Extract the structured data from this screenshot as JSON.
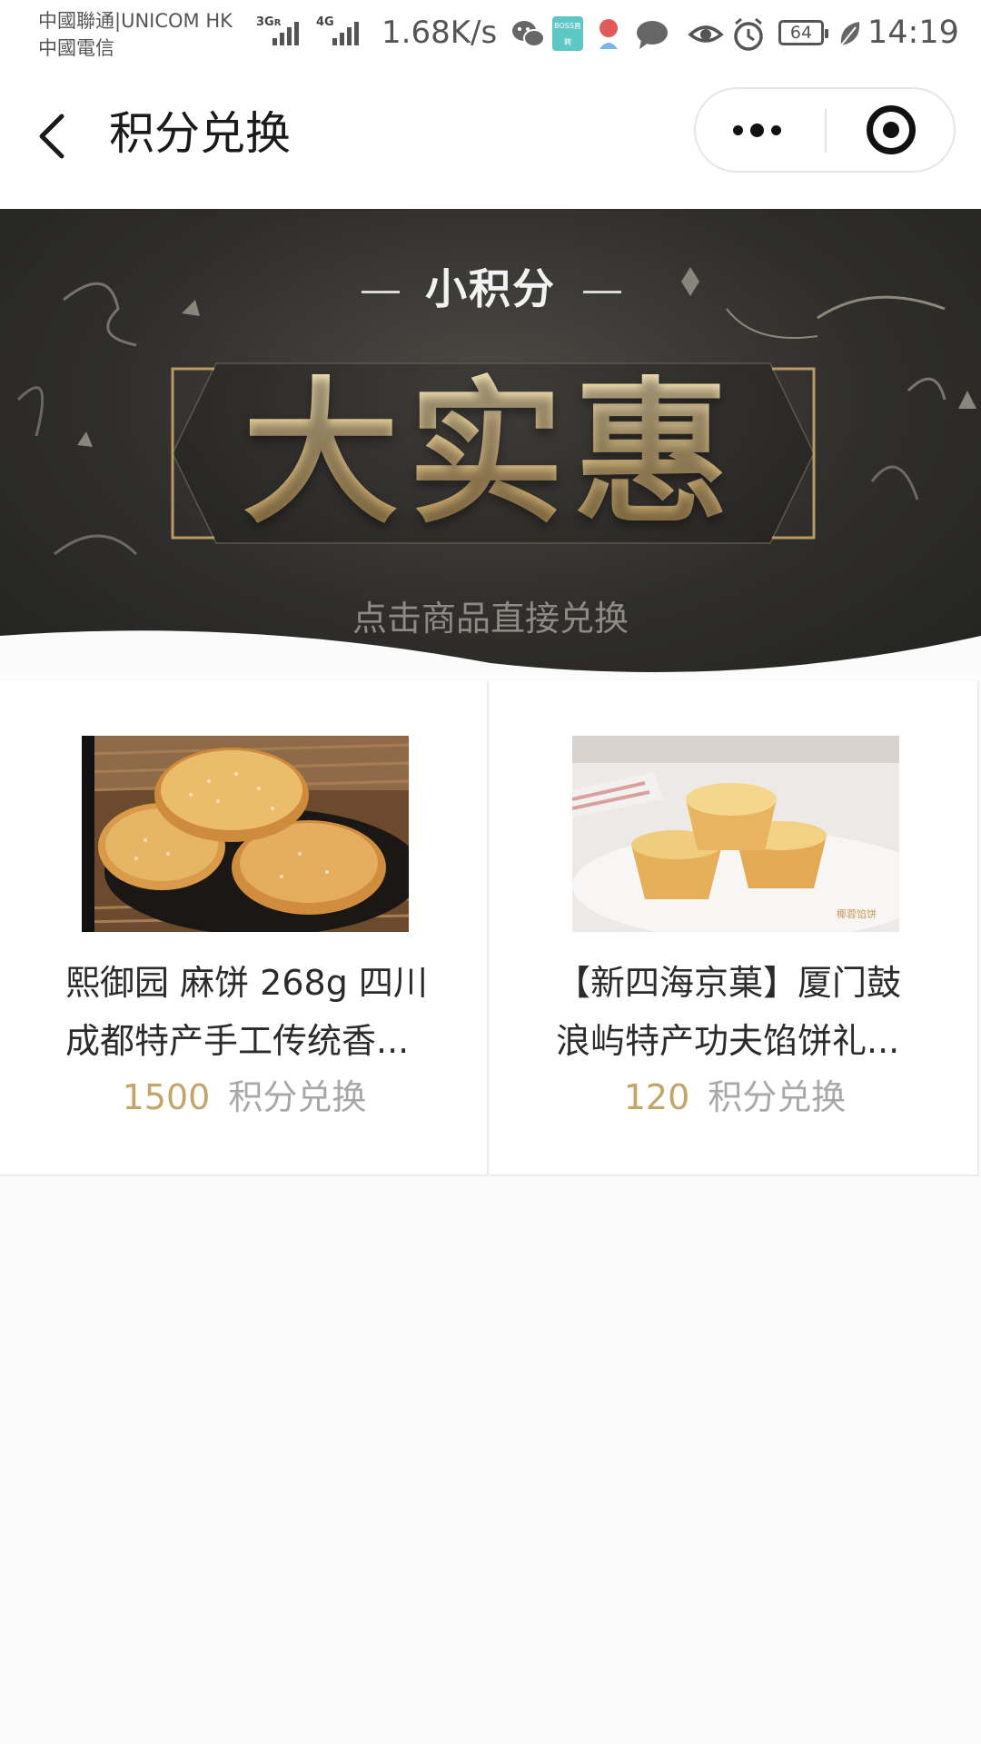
{
  "status_bar": {
    "carrier_line1": "中國聯通|UNICOM HK",
    "carrier_line2": "中國電信",
    "network_1": "3G",
    "network_1_suffix": "R",
    "network_2": "4G",
    "network_speed": "1.68K/s",
    "app_badge_label": "BOSS直聘",
    "battery_level": "64",
    "time": "14:19"
  },
  "nav": {
    "title": "积分兑换",
    "icons": [
      "back-arrow-icon",
      "more-dots-icon",
      "close-target-icon"
    ]
  },
  "banner": {
    "subtitle": "小积分",
    "headline": "大实惠",
    "hint": "点击商品直接兑换"
  },
  "products": [
    {
      "name_line1": "熙御园 麻饼 268g 四川",
      "name_line2": "成都特产手工传统香...",
      "price": "1500",
      "price_unit": "积分兑换",
      "image": "sesame-cakes-image"
    },
    {
      "name_line1": "【新四海京菓】厦门鼓",
      "name_line2": "浪屿特产功夫馅饼礼...",
      "price": "120",
      "price_unit": "积分兑换",
      "image": "coconut-tarts-image",
      "image_watermark": "椰蓉馅饼"
    }
  ],
  "colors": {
    "accent_gold": "#c2a568",
    "muted_text": "#a8a8a8",
    "banner_dark": "#2f2e2c"
  }
}
